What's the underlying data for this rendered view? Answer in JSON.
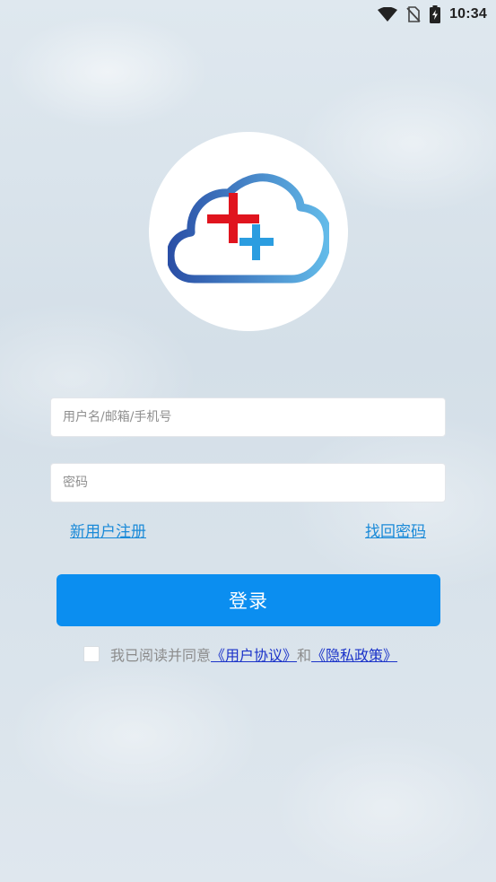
{
  "status_bar": {
    "time": "10:34",
    "icons": [
      "wifi-icon",
      "no-sim-icon",
      "battery-charging-icon"
    ]
  },
  "logo": {
    "icon": "cloud-medical-cross-logo",
    "colors": {
      "cloud_gradient_start": "#2a54a8",
      "cloud_gradient_end": "#62b9e8",
      "cross_red": "#e0141e",
      "cross_blue": "#2b9de0"
    }
  },
  "form": {
    "username_placeholder": "用户名/邮箱/手机号",
    "username_value": "",
    "password_placeholder": "密码",
    "password_value": ""
  },
  "links": {
    "register": "新用户注册",
    "forgot_password": "找回密码"
  },
  "login_button": {
    "label": "登录",
    "color": "#0b8ef0"
  },
  "agreement": {
    "checked": false,
    "prefix": "我已阅读并同意",
    "user_agreement": "《用户协议》",
    "and": "和",
    "privacy_policy": "《隐私政策》"
  }
}
